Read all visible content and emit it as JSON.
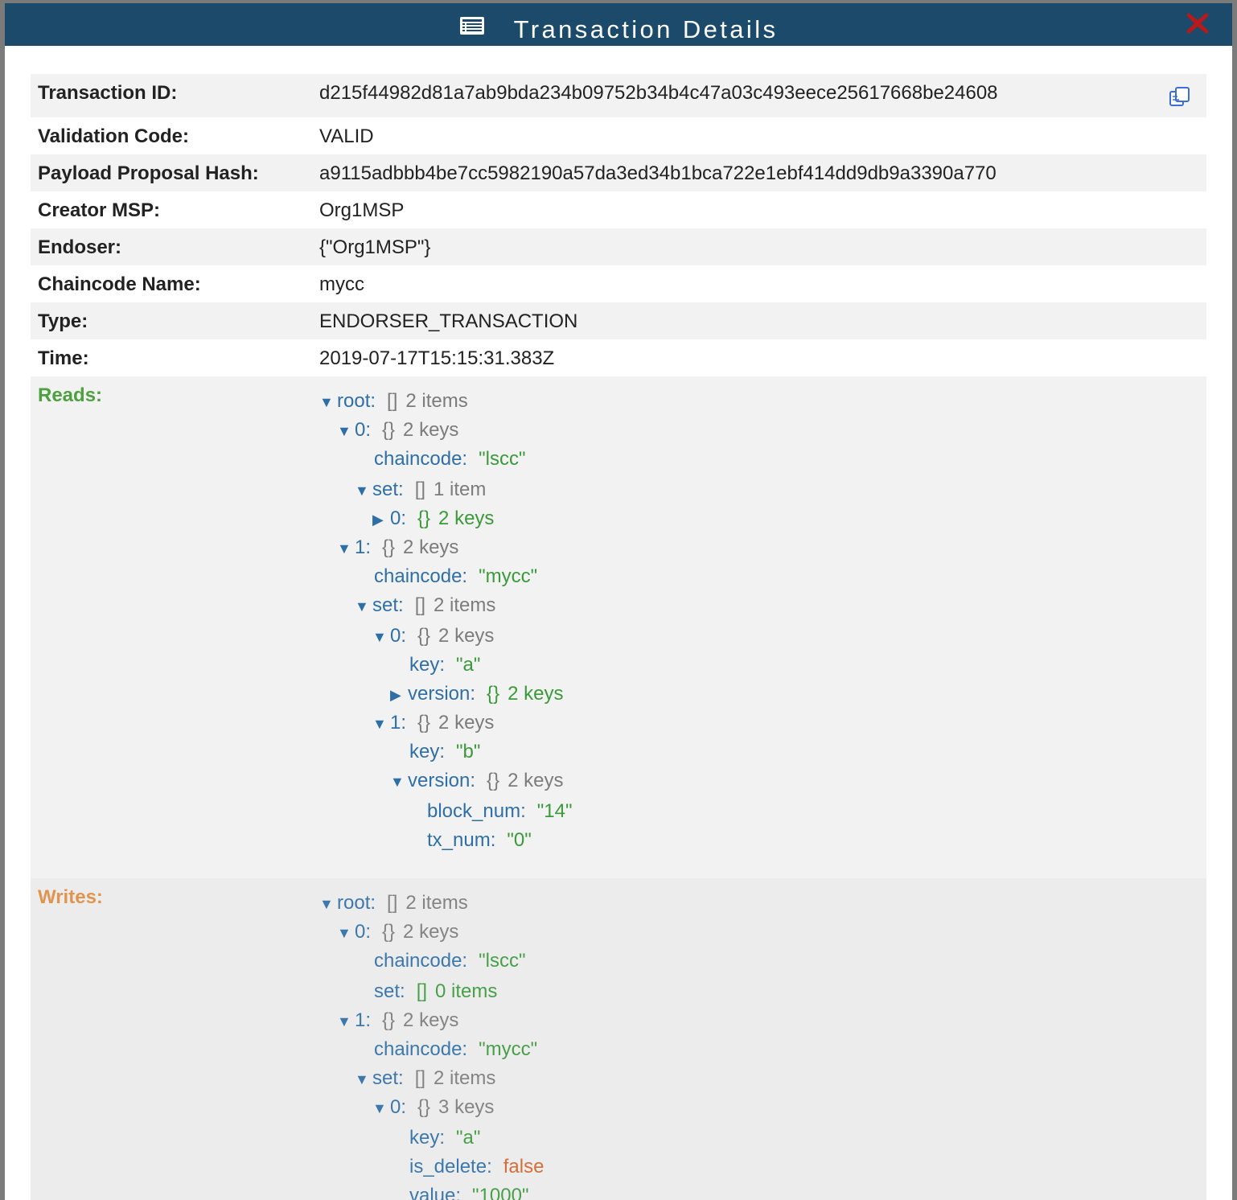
{
  "dialog": {
    "title": "Transaction Details"
  },
  "details": [
    {
      "label": "Transaction ID:",
      "value": "d215f44982d81a7ab9bda234b09752b34b4c47a03c493eece25617668be24608"
    },
    {
      "label": "Validation Code:",
      "value": "VALID"
    },
    {
      "label": "Payload Proposal Hash:",
      "value": "a9115adbbb4be7cc5982190a57da3ed34b1bca722e1ebf414dd9db9a3390a770"
    },
    {
      "label": "Creator MSP:",
      "value": "Org1MSP"
    },
    {
      "label": "Endoser:",
      "value": "{\"Org1MSP\"}"
    },
    {
      "label": "Chaincode Name:",
      "value": "mycc"
    },
    {
      "label": "Type:",
      "value": "ENDORSER_TRANSACTION"
    },
    {
      "label": "Time:",
      "value": "2019-07-17T15:15:31.383Z"
    }
  ],
  "reads": {
    "label": "Reads:",
    "tree": [
      {
        "key": "root:",
        "toggle": "expanded",
        "type": "[]",
        "summary": "2 items"
      },
      {
        "key": "0:",
        "toggle": "expanded",
        "type": "{}",
        "summary": "2 keys"
      },
      {
        "key": "chaincode:",
        "value": "\"lscc\""
      },
      {
        "key": "set:",
        "toggle": "expanded",
        "type": "[]",
        "summary": "1 item"
      },
      {
        "key": "0:",
        "toggle": "collapsed",
        "type": "{}",
        "summary": "2 keys"
      },
      {
        "key": "1:",
        "toggle": "expanded",
        "type": "{}",
        "summary": "2 keys"
      },
      {
        "key": "chaincode:",
        "value": "\"mycc\""
      },
      {
        "key": "set:",
        "toggle": "expanded",
        "type": "[]",
        "summary": "2 items"
      },
      {
        "key": "0:",
        "toggle": "expanded",
        "type": "{}",
        "summary": "2 keys"
      },
      {
        "key": "key:",
        "value": "\"a\""
      },
      {
        "key": "version:",
        "toggle": "collapsed",
        "type": "{}",
        "summary": "2 keys"
      },
      {
        "key": "1:",
        "toggle": "expanded",
        "type": "{}",
        "summary": "2 keys"
      },
      {
        "key": "key:",
        "value": "\"b\""
      },
      {
        "key": "version:",
        "toggle": "expanded",
        "type": "{}",
        "summary": "2 keys"
      },
      {
        "key": "block_num:",
        "value": "\"14\""
      },
      {
        "key": "tx_num:",
        "value": "\"0\""
      }
    ]
  },
  "writes": {
    "label": "Writes:",
    "tree": [
      {
        "key": "root:",
        "toggle": "expanded",
        "type": "[]",
        "summary": "2 items"
      },
      {
        "key": "0:",
        "toggle": "expanded",
        "type": "{}",
        "summary": "2 keys"
      },
      {
        "key": "chaincode:",
        "value": "\"lscc\""
      },
      {
        "key": "set:",
        "type": "[]",
        "value": "0 items"
      },
      {
        "key": "1:",
        "toggle": "expanded",
        "type": "{}",
        "summary": "2 keys"
      },
      {
        "key": "chaincode:",
        "value": "\"mycc\""
      },
      {
        "key": "set:",
        "toggle": "expanded",
        "type": "[]",
        "summary": "2 items"
      },
      {
        "key": "0:",
        "toggle": "expanded",
        "type": "{}",
        "summary": "3 keys"
      },
      {
        "key": "key:",
        "value": "\"a\""
      },
      {
        "key": "is_delete:",
        "value": "false"
      },
      {
        "key": "value:",
        "value": "\"1000\""
      }
    ]
  },
  "colors": {
    "header": "#1c4a6a",
    "reads_label": "#4ea13e",
    "writes_label": "#e0954f",
    "key": "#2f6fa8",
    "string": "#3a9a3a",
    "boolean": "#d4642a",
    "close": "#b8191a"
  },
  "icons": {
    "title": "list-icon",
    "close": "close-x-icon",
    "copy": "copy-icon",
    "expanded": "triangle-down-icon",
    "collapsed": "triangle-right-icon"
  }
}
